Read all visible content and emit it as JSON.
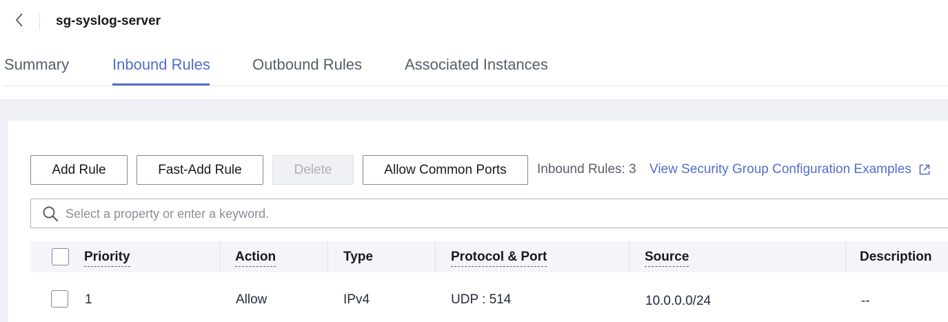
{
  "header": {
    "back_icon": "chevron-left-icon",
    "title": "sg-syslog-server"
  },
  "tabs": [
    {
      "label": "Summary",
      "active": false
    },
    {
      "label": "Inbound Rules",
      "active": true
    },
    {
      "label": "Outbound Rules",
      "active": false
    },
    {
      "label": "Associated Instances",
      "active": false
    }
  ],
  "toolbar": {
    "add_rule": "Add Rule",
    "fast_add_rule": "Fast-Add Rule",
    "delete": "Delete",
    "allow_common_ports": "Allow Common Ports",
    "rule_count": "Inbound Rules: 3",
    "examples_link": "View Security Group Configuration Examples"
  },
  "search": {
    "placeholder": "Select a property or enter a keyword.",
    "value": ""
  },
  "table": {
    "columns": [
      "Priority",
      "Action",
      "Type",
      "Protocol & Port",
      "Source",
      "Description"
    ],
    "rows": [
      {
        "priority": "1",
        "action": "Allow",
        "type": "IPv4",
        "protocol_port": "UDP : 514",
        "source": "10.0.0.0/24",
        "description": "--"
      }
    ]
  },
  "colors": {
    "accent": "#526ecc",
    "text": "#191919",
    "muted": "#575d6c",
    "page_bg": "#eef0f5",
    "table_header_bg": "#f3f5fb"
  }
}
